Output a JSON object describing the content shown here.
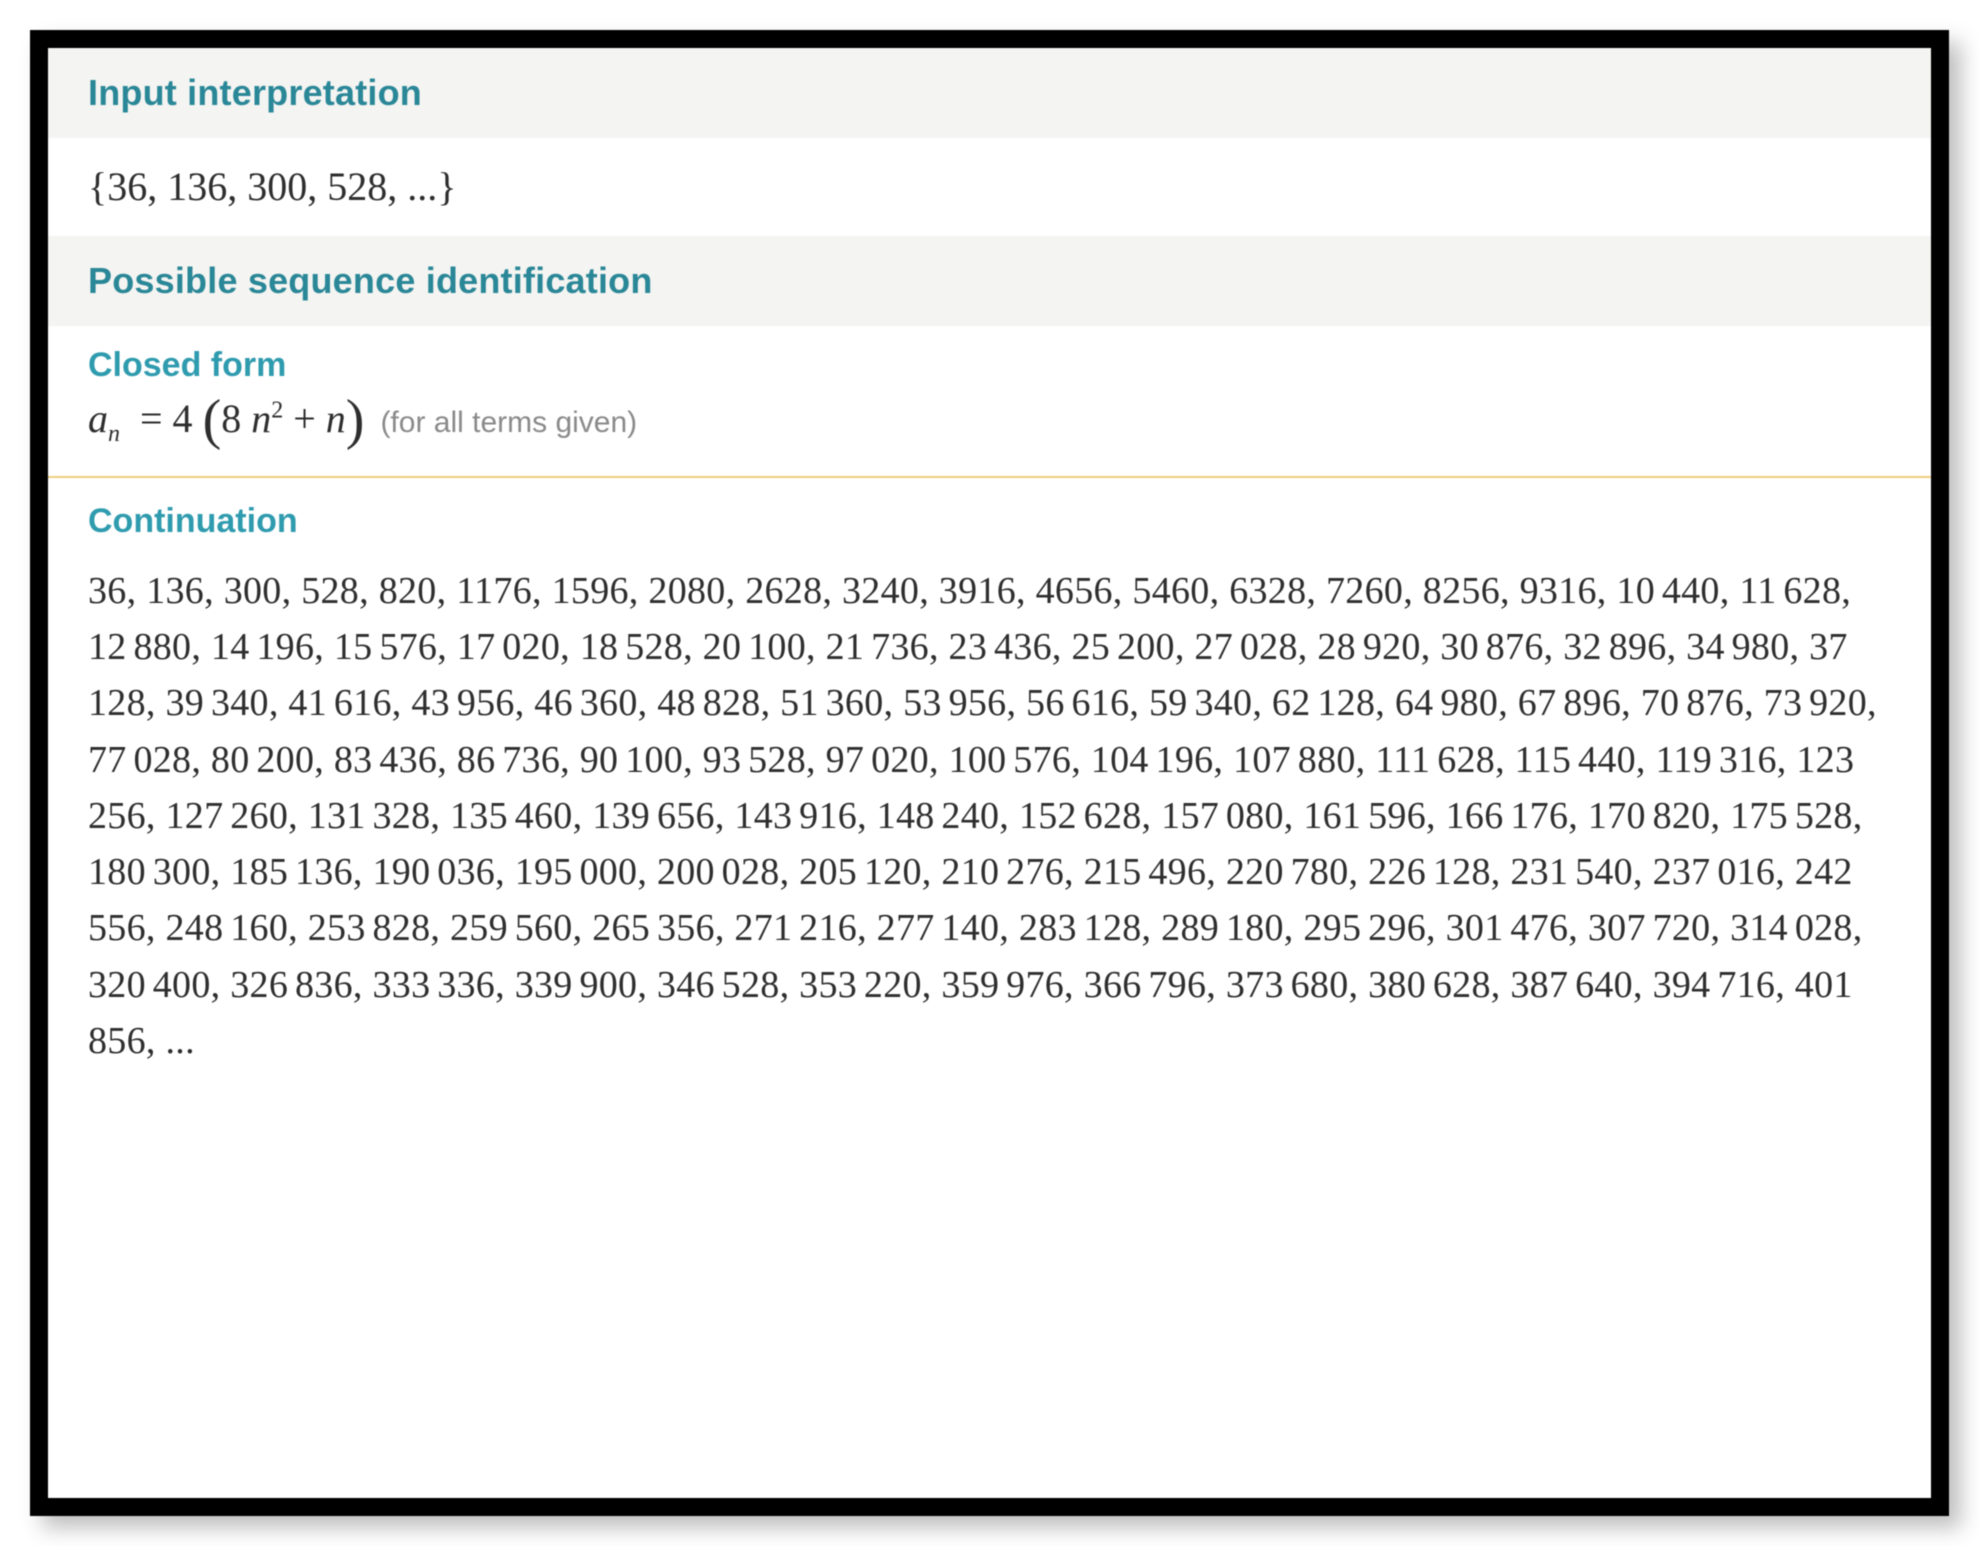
{
  "headers": {
    "input_interpretation": "Input interpretation",
    "possible_sequence_id": "Possible sequence identification",
    "closed_form": "Closed form",
    "continuation": "Continuation"
  },
  "input_sequence_display": "{36, 136, 300, 528, ...}",
  "closed_form": {
    "lhs_variable": "a",
    "lhs_subscript": "n",
    "formula_plain": "4 (8 n^2 + n)",
    "note": "(for all terms given)"
  },
  "continuation_values": [
    36,
    136,
    300,
    528,
    820,
    1176,
    1596,
    2080,
    2628,
    3240,
    3916,
    4656,
    5460,
    6328,
    7260,
    8256,
    9316,
    10440,
    11628,
    12880,
    14196,
    15576,
    17020,
    18528,
    20100,
    21736,
    23436,
    25200,
    27028,
    28920,
    30876,
    32896,
    34980,
    37128,
    39340,
    41616,
    43956,
    46360,
    48828,
    51360,
    53956,
    56616,
    59340,
    62128,
    64980,
    67896,
    70876,
    73920,
    77028,
    80200,
    83436,
    86736,
    90100,
    93528,
    97020,
    100576,
    104196,
    107880,
    111628,
    115440,
    119316,
    123256,
    127260,
    131328,
    135460,
    139656,
    143916,
    148240,
    152628,
    157080,
    161596,
    166176,
    170820,
    175528,
    180300,
    185136,
    190036,
    195000,
    200028,
    205120,
    210276,
    215496,
    220780,
    226128,
    231540,
    237016,
    242556,
    248160,
    253828,
    259560,
    265356,
    271216,
    277140,
    283128,
    289180,
    295296,
    301476,
    307720,
    314028,
    320400,
    326836,
    333336,
    339900,
    346528,
    353220,
    359976,
    366796,
    373680,
    380628,
    387640,
    394716,
    401856
  ],
  "continuation_trailing": ", ..."
}
